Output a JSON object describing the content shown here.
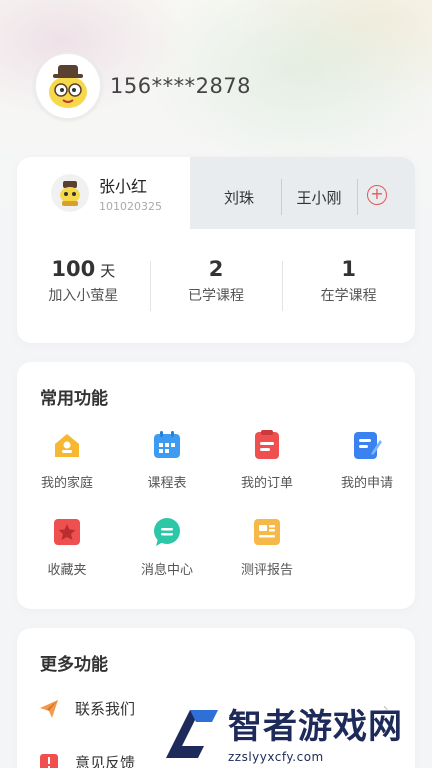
{
  "profile": {
    "phone": "156****2878",
    "avatar_icon": "yellow-character-avatar"
  },
  "children": {
    "active": {
      "name": "张小红",
      "id": "101020325"
    },
    "others": [
      "刘珠",
      "王小刚"
    ],
    "add_icon": "plus-circle-icon"
  },
  "stats": [
    {
      "value": "100",
      "unit": "天",
      "label": "加入小萤星"
    },
    {
      "value": "2",
      "unit": "",
      "label": "已学课程"
    },
    {
      "value": "1",
      "unit": "",
      "label": "在学课程"
    }
  ],
  "common_functions": {
    "title": "常用功能",
    "items": [
      {
        "label": "我的家庭",
        "icon": "home-icon",
        "color": "#f5b830"
      },
      {
        "label": "课程表",
        "icon": "calendar-icon",
        "color": "#3d9cf2"
      },
      {
        "label": "我的订单",
        "icon": "order-icon",
        "color": "#ef4f4f"
      },
      {
        "label": "我的申请",
        "icon": "application-icon",
        "color": "#3a82f0"
      },
      {
        "label": "收藏夹",
        "icon": "favorites-icon",
        "color": "#ef4f4f"
      },
      {
        "label": "消息中心",
        "icon": "message-icon",
        "color": "#2cc7a6"
      },
      {
        "label": "测评报告",
        "icon": "report-icon",
        "color": "#f7b84a"
      }
    ]
  },
  "more_functions": {
    "title": "更多功能",
    "items": [
      {
        "label": "联系我们",
        "icon": "paper-plane-icon",
        "color": "#f49a4a"
      },
      {
        "label": "意见反馈",
        "icon": "feedback-icon",
        "color": "#ef4f4f"
      }
    ]
  },
  "watermark": {
    "brand": "智者游戏网",
    "url": "zzslyyxcfy.com"
  }
}
